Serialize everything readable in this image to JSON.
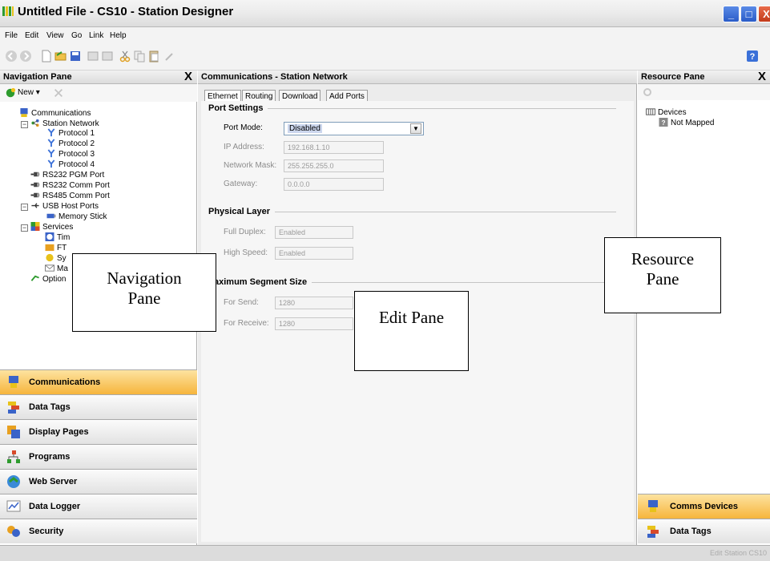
{
  "window": {
    "title": "Untitled File - CS10 - Station Designer",
    "min": "_",
    "max": "□",
    "close": "X"
  },
  "menu": [
    "File",
    "Edit",
    "View",
    "Go",
    "Link",
    "Help"
  ],
  "nav_pane": {
    "title": "Navigation Pane",
    "close": "X",
    "new_label": "New ▾",
    "tree": [
      "Communications",
      "Station Network",
      "Protocol 1",
      "Protocol 2",
      "Protocol 3",
      "Protocol 4",
      "RS232 PGM Port",
      "RS232 Comm Port",
      "RS485 Comm Port",
      "USB Host Ports",
      "Memory Stick",
      "Services",
      "Tim",
      "FT",
      "Sy",
      "Ma",
      "Option"
    ],
    "buttons": [
      "Communications",
      "Data Tags",
      "Display Pages",
      "Programs",
      "Web Server",
      "Data Logger",
      "Security"
    ]
  },
  "edit_pane": {
    "title": "Communications - Station Network",
    "tabs": [
      "Ethernet",
      "Routing",
      "Download",
      "Add Ports"
    ],
    "port_settings": {
      "title": "Port Settings",
      "port_mode_label": "Port Mode:",
      "port_mode_value": "Disabled",
      "ip_label": "IP Address:",
      "ip_value": "192.168.1.10",
      "mask_label": "Network Mask:",
      "mask_value": "255.255.255.0",
      "gateway_label": "Gateway:",
      "gateway_value": "0.0.0.0"
    },
    "physical_layer": {
      "title": "Physical Layer",
      "duplex_label": "Full Duplex:",
      "duplex_value": "Enabled",
      "speed_label": "High Speed:",
      "speed_value": "Enabled"
    },
    "segment": {
      "title": "aximum Segment Size",
      "send_label": "For Send:",
      "send_value": "1280",
      "recv_label": "For Receive:",
      "recv_value": "1280"
    }
  },
  "res_pane": {
    "title": "Resource Pane",
    "close": "X",
    "tree": [
      "Devices",
      "Not Mapped"
    ],
    "buttons": [
      "Comms Devices",
      "Data Tags"
    ]
  },
  "annotations": {
    "nav": [
      "Navigation",
      "Pane"
    ],
    "edit": "Edit Pane",
    "res": [
      "Resource",
      "Pane"
    ]
  },
  "status": {
    "text": "Edit Station CS10"
  }
}
